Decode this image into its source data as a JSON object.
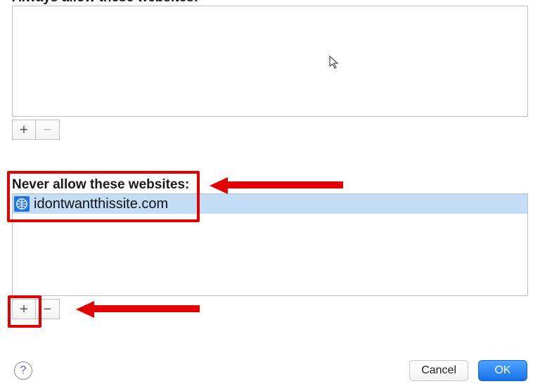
{
  "allow_section": {
    "label": "Always allow these websites:",
    "items": [],
    "add_label": "+",
    "remove_label": "−",
    "remove_enabled": false
  },
  "never_section": {
    "label": "Never allow these websites:",
    "items": [
      {
        "url": "idontwantthissite.com",
        "icon": "globe-icon",
        "selected": true
      }
    ],
    "add_label": "+",
    "remove_label": "−",
    "remove_enabled": true
  },
  "footer": {
    "help_label": "?",
    "cancel_label": "Cancel",
    "ok_label": "OK"
  },
  "annotations": {
    "highlight_never_label": true,
    "highlight_add_button": true
  }
}
